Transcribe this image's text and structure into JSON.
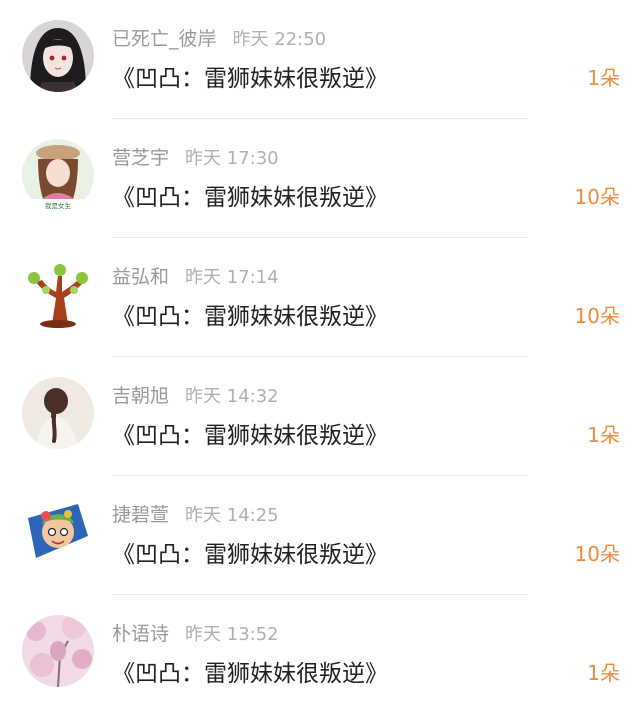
{
  "gifts": [
    {
      "user": "已死亡_彼岸",
      "time": "昨天 22:50",
      "title": "《凹凸：雷狮妹妹很叛逆》",
      "count": "1朵",
      "avatar_icon": "anime-girl-red-eyes-avatar"
    },
    {
      "user": "营芝宇",
      "time": "昨天 17:30",
      "title": "《凹凸：雷狮妹妹很叛逆》",
      "count": "10朵",
      "avatar_icon": "girl-with-hat-avatar",
      "avatar_caption": "我是女生"
    },
    {
      "user": "益弘和",
      "time": "昨天 17:14",
      "title": "《凹凸：雷狮妹妹很叛逆》",
      "count": "10朵",
      "avatar_icon": "cartoon-tree-avatar"
    },
    {
      "user": "吉朝旭",
      "time": "昨天 14:32",
      "title": "《凹凸：雷狮妹妹很叛逆》",
      "count": "1朵",
      "avatar_icon": "girl-back-braid-avatar"
    },
    {
      "user": "捷碧萱",
      "time": "昨天 14:25",
      "title": "《凹凸：雷狮妹妹很叛逆》",
      "count": "10朵",
      "avatar_icon": "cartoon-character-avatar"
    },
    {
      "user": "朴语诗",
      "time": "昨天 13:52",
      "title": "《凹凸：雷狮妹妹很叛逆》",
      "count": "1朵",
      "avatar_icon": "pink-blossom-avatar"
    }
  ],
  "colors": {
    "count": "#f08a3c",
    "name": "#9a9a9a",
    "title": "#222222",
    "divider": "#ececec"
  }
}
